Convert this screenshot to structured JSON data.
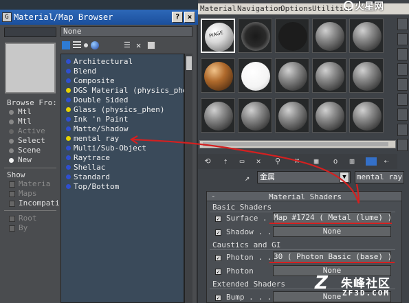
{
  "browser": {
    "title": "Material/Map Browser",
    "help_label": "?",
    "close_label": "×",
    "name_value": "None",
    "browse_from": {
      "heading": "Browse Fro:",
      "options": [
        "Mtl",
        "Mtl",
        "Active",
        "Select",
        "Scene",
        "New"
      ]
    },
    "show": {
      "heading": "Show",
      "items": [
        "Materia",
        "Maps",
        "Incompati"
      ]
    },
    "extra": {
      "items": [
        "Root",
        "By"
      ]
    },
    "list": [
      {
        "label": "Architectural",
        "color": "#2f4fd0"
      },
      {
        "label": "Blend",
        "color": "#2f4fd0"
      },
      {
        "label": "Composite",
        "color": "#2f4fd0"
      },
      {
        "label": "DGS Material (physics_phe",
        "color": "#e6d200"
      },
      {
        "label": "Double Sided",
        "color": "#2f4fd0"
      },
      {
        "label": "Glass (physics_phen)",
        "color": "#e6d200"
      },
      {
        "label": "Ink 'n Paint",
        "color": "#2f4fd0"
      },
      {
        "label": "Matte/Shadow",
        "color": "#2f4fd0"
      },
      {
        "label": "mental ray",
        "color": "#e6d200"
      },
      {
        "label": "Multi/Sub-Object",
        "color": "#2f4fd0"
      },
      {
        "label": "Raytrace",
        "color": "#2f4fd0"
      },
      {
        "label": "Shellac",
        "color": "#2f4fd0"
      },
      {
        "label": "Standard",
        "color": "#2f4fd0"
      },
      {
        "label": "Top/Bottom",
        "color": "#2f4fd0"
      }
    ]
  },
  "editor": {
    "menu": [
      "Material",
      "Navigation",
      "Options",
      "Utilities"
    ],
    "slot_label": "PIAGE",
    "material_name": "金属",
    "material_type": "mental ray",
    "rollout_title": "Material Shaders",
    "basic_heading": "Basic Shaders",
    "surface_label": "Surface . .",
    "surface_value": "Map #1724  ( Metal (lume) )",
    "shadow_label": "Shadow . .",
    "shadow_value": "None",
    "caustics_heading": "Caustics and GI",
    "photon_label": "Photon . .",
    "photon_value": "30  ( Photon Basic (base) )",
    "photon_vol_label": "Photon",
    "photon_vol_value": "None",
    "extended_heading": "Extended Shaders",
    "bump_label": "Bump . . .",
    "bump_value": "None"
  },
  "watermark": {
    "top": "火星网",
    "bottom_cn": "朱峰社区",
    "bottom_en": "ZF3D.COM"
  },
  "colors": {
    "accent_red": "#d42020",
    "title_blue": "#1b4f9c"
  }
}
